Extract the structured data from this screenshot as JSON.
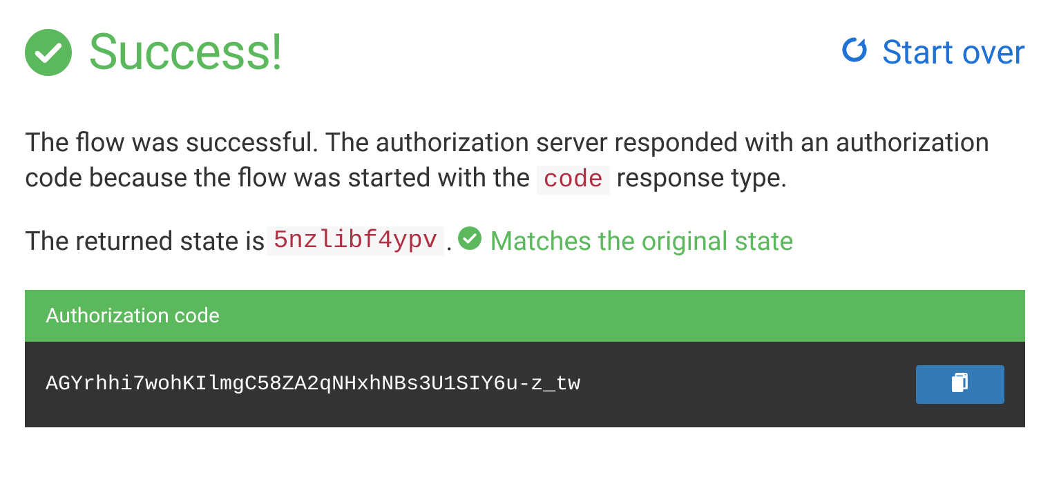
{
  "header": {
    "title": "Success!",
    "start_over_label": "Start over"
  },
  "description": {
    "prefix": "The flow was successful. The authorization server responded with an authorization code because the flow was started with the ",
    "code_token": "code",
    "suffix": " response type."
  },
  "state": {
    "prefix": "The returned state is ",
    "value": "5nzlibf4ypv",
    "period": ". ",
    "match_label": "Matches the original state"
  },
  "auth_code": {
    "header": "Authorization code",
    "value": "AGYrhhi7wohKIlmgC58ZA2qNHxhNBs3U1SIY6u-z_tw"
  },
  "colors": {
    "green": "#5cb85c",
    "blue_link": "#1f71d4",
    "blue_btn": "#337ab7",
    "code_red": "#b03043",
    "code_bg": "#f7f7f7",
    "panel_dark": "#333333"
  }
}
